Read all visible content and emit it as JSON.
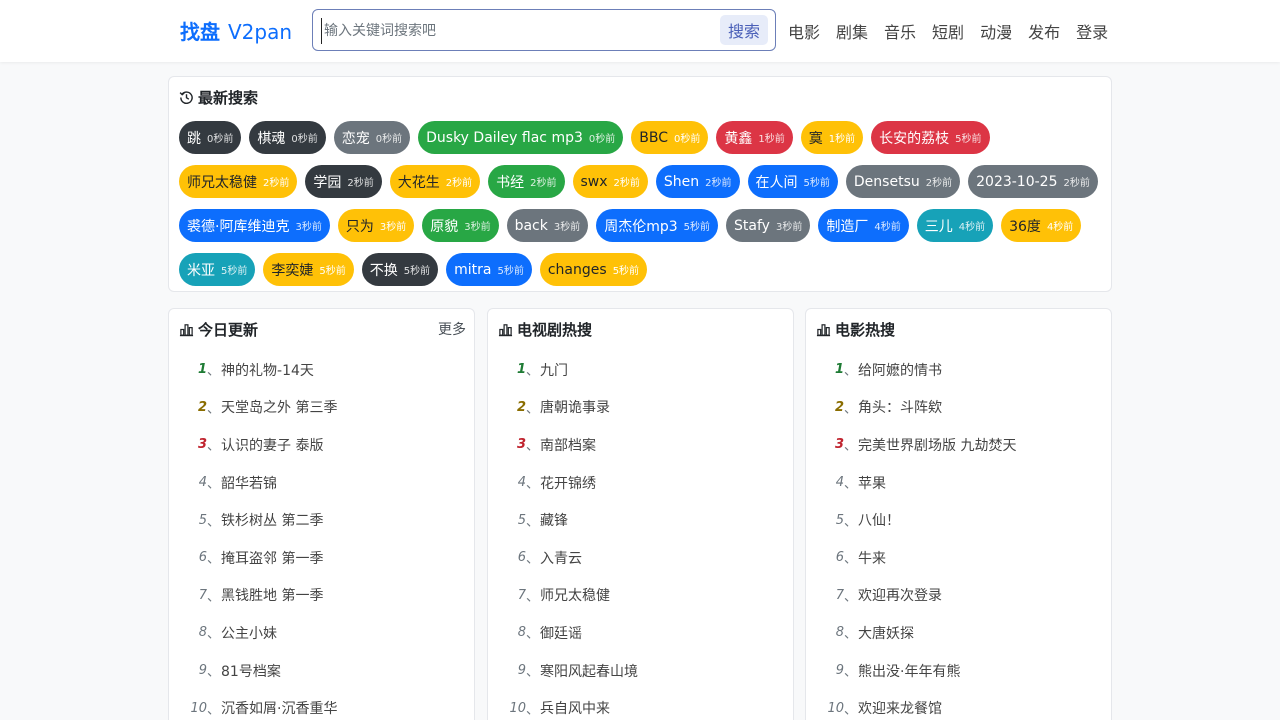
{
  "header": {
    "logo_cn": "找盘",
    "logo_en": "V2pan",
    "search_placeholder": "输入关键词搜索吧",
    "search_button": "搜索",
    "nav": [
      "电影",
      "剧集",
      "音乐",
      "短剧",
      "动漫",
      "发布",
      "登录"
    ]
  },
  "recent": {
    "title": "最新搜索",
    "tags": [
      {
        "text": "跳",
        "time": "0秒前",
        "color": "dark"
      },
      {
        "text": "棋魂",
        "time": "0秒前",
        "color": "dark"
      },
      {
        "text": "恋宠",
        "time": "0秒前",
        "color": "gray"
      },
      {
        "text": "Dusky Dailey flac mp3",
        "time": "0秒前",
        "color": "green"
      },
      {
        "text": "BBC",
        "time": "0秒前",
        "color": "yellow"
      },
      {
        "text": "黄鑫",
        "time": "1秒前",
        "color": "red"
      },
      {
        "text": "寞",
        "time": "1秒前",
        "color": "yellow"
      },
      {
        "text": "长安的荔枝",
        "time": "5秒前",
        "color": "red"
      },
      {
        "text": "师兄太稳健",
        "time": "2秒前",
        "color": "yellow"
      },
      {
        "text": "学园",
        "time": "2秒前",
        "color": "dark"
      },
      {
        "text": "大花生",
        "time": "2秒前",
        "color": "yellow"
      },
      {
        "text": "书经",
        "time": "2秒前",
        "color": "green"
      },
      {
        "text": "swx",
        "time": "2秒前",
        "color": "yellow"
      },
      {
        "text": "Shen",
        "time": "2秒前",
        "color": "blue"
      },
      {
        "text": "在人间",
        "time": "5秒前",
        "color": "blue"
      },
      {
        "text": "Densetsu",
        "time": "2秒前",
        "color": "gray"
      },
      {
        "text": "2023-10-25",
        "time": "2秒前",
        "color": "gray"
      },
      {
        "text": "裘德·阿库维迪克",
        "time": "3秒前",
        "color": "blue"
      },
      {
        "text": "只为",
        "time": "3秒前",
        "color": "yellow"
      },
      {
        "text": "原貌",
        "time": "3秒前",
        "color": "green"
      },
      {
        "text": "back",
        "time": "3秒前",
        "color": "gray"
      },
      {
        "text": "周杰伦mp3",
        "time": "5秒前",
        "color": "blue"
      },
      {
        "text": "Stafy",
        "time": "3秒前",
        "color": "gray"
      },
      {
        "text": "制造厂",
        "time": "4秒前",
        "color": "blue"
      },
      {
        "text": "三儿",
        "time": "4秒前",
        "color": "cyan"
      },
      {
        "text": "36度",
        "time": "4秒前",
        "color": "yellow"
      },
      {
        "text": "米亚",
        "time": "5秒前",
        "color": "cyan"
      },
      {
        "text": "李奕婕",
        "time": "5秒前",
        "color": "yellow"
      },
      {
        "text": "不换",
        "time": "5秒前",
        "color": "dark"
      },
      {
        "text": "mitra",
        "time": "5秒前",
        "color": "blue"
      },
      {
        "text": "changes",
        "time": "5秒前",
        "color": "yellow"
      }
    ]
  },
  "lists": [
    {
      "title": "今日更新",
      "more": "更多",
      "items": [
        "神的礼物-14天",
        "天堂岛之外 第三季",
        "认识的妻子 泰版",
        "韶华若锦",
        "铁杉树丛 第二季",
        "掩耳盗邻 第一季",
        "黑钱胜地 第一季",
        "公主小妹",
        "81号档案",
        "沉香如屑·沉香重华"
      ]
    },
    {
      "title": "电视剧热搜",
      "more": "",
      "items": [
        "九门",
        "唐朝诡事录",
        "南部档案",
        "花开锦绣",
        "藏锋",
        "入青云",
        "师兄太稳健",
        "御廷谣",
        "寒阳风起春山境",
        "兵自风中来"
      ]
    },
    {
      "title": "电影热搜",
      "more": "",
      "items": [
        "给阿嬷的情书",
        "角头：斗阵欸",
        "完美世界剧场版 九劫焚天",
        "苹果",
        "八仙！",
        "牛来",
        "欢迎再次登录",
        "大唐妖探",
        "熊出没·年年有熊",
        "欢迎来龙餐馆"
      ]
    }
  ],
  "rank_separator": "、",
  "colors": {
    "accent": "#0d6efd",
    "dark": "#343a40",
    "gray": "#6c757d",
    "green": "#28a745",
    "yellow": "#ffc107",
    "red": "#dc3545",
    "blue": "#0d6efd",
    "cyan": "#17a2b8"
  },
  "icons": {
    "recent": "history-icon",
    "list": "bar-chart-icon"
  }
}
